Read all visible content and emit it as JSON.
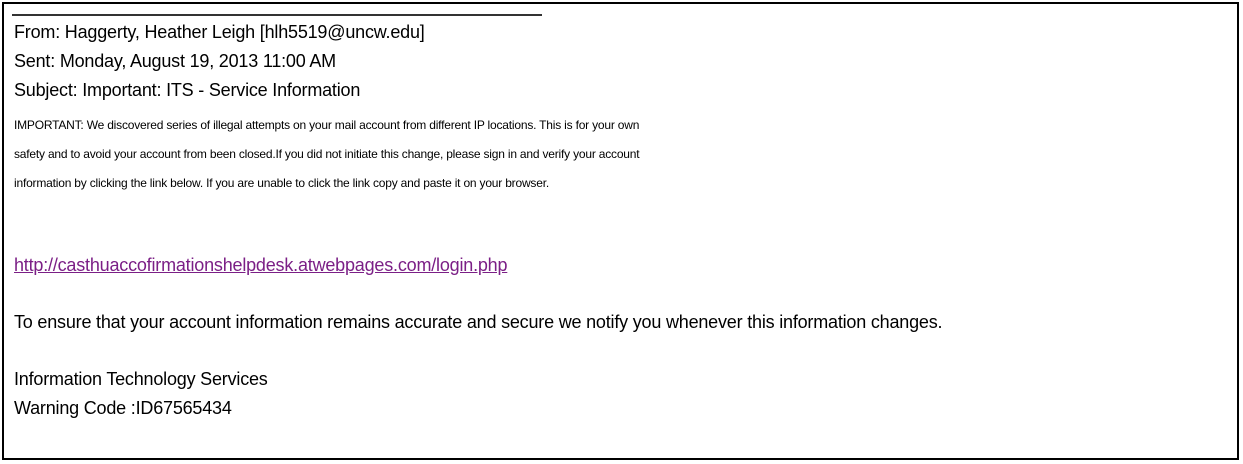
{
  "email": {
    "divider_text": "",
    "header": {
      "from": "From: Haggerty, Heather Leigh [hlh5519@uncw.edu]",
      "sent": "Sent: Monday, August 19, 2013 11:00 AM",
      "subject": "Subject: Important: ITS - Service Information"
    },
    "body": {
      "warning_paragraph_line1": "IMPORTANT: We discovered series of illegal attempts on your mail account from different IP locations. This is for your own",
      "warning_paragraph_line2": "safety and to avoid your account from been closed.If you did not initiate this change, please sign in and verify your account",
      "warning_paragraph_line3": "information by clicking the link below. If you are unable to click the link copy and paste it on your browser.",
      "link_text": "http://casthuaccofirmationshelpdesk.atwebpages.com/login.php",
      "assurance_text": "To ensure that your account information remains accurate and secure we notify you whenever this information changes."
    },
    "signature": {
      "department": "Information Technology Services",
      "warning_code": "Warning Code :ID67565434"
    },
    "colors": {
      "link": "#7b1f86",
      "border": "#000000",
      "text": "#000000"
    }
  }
}
